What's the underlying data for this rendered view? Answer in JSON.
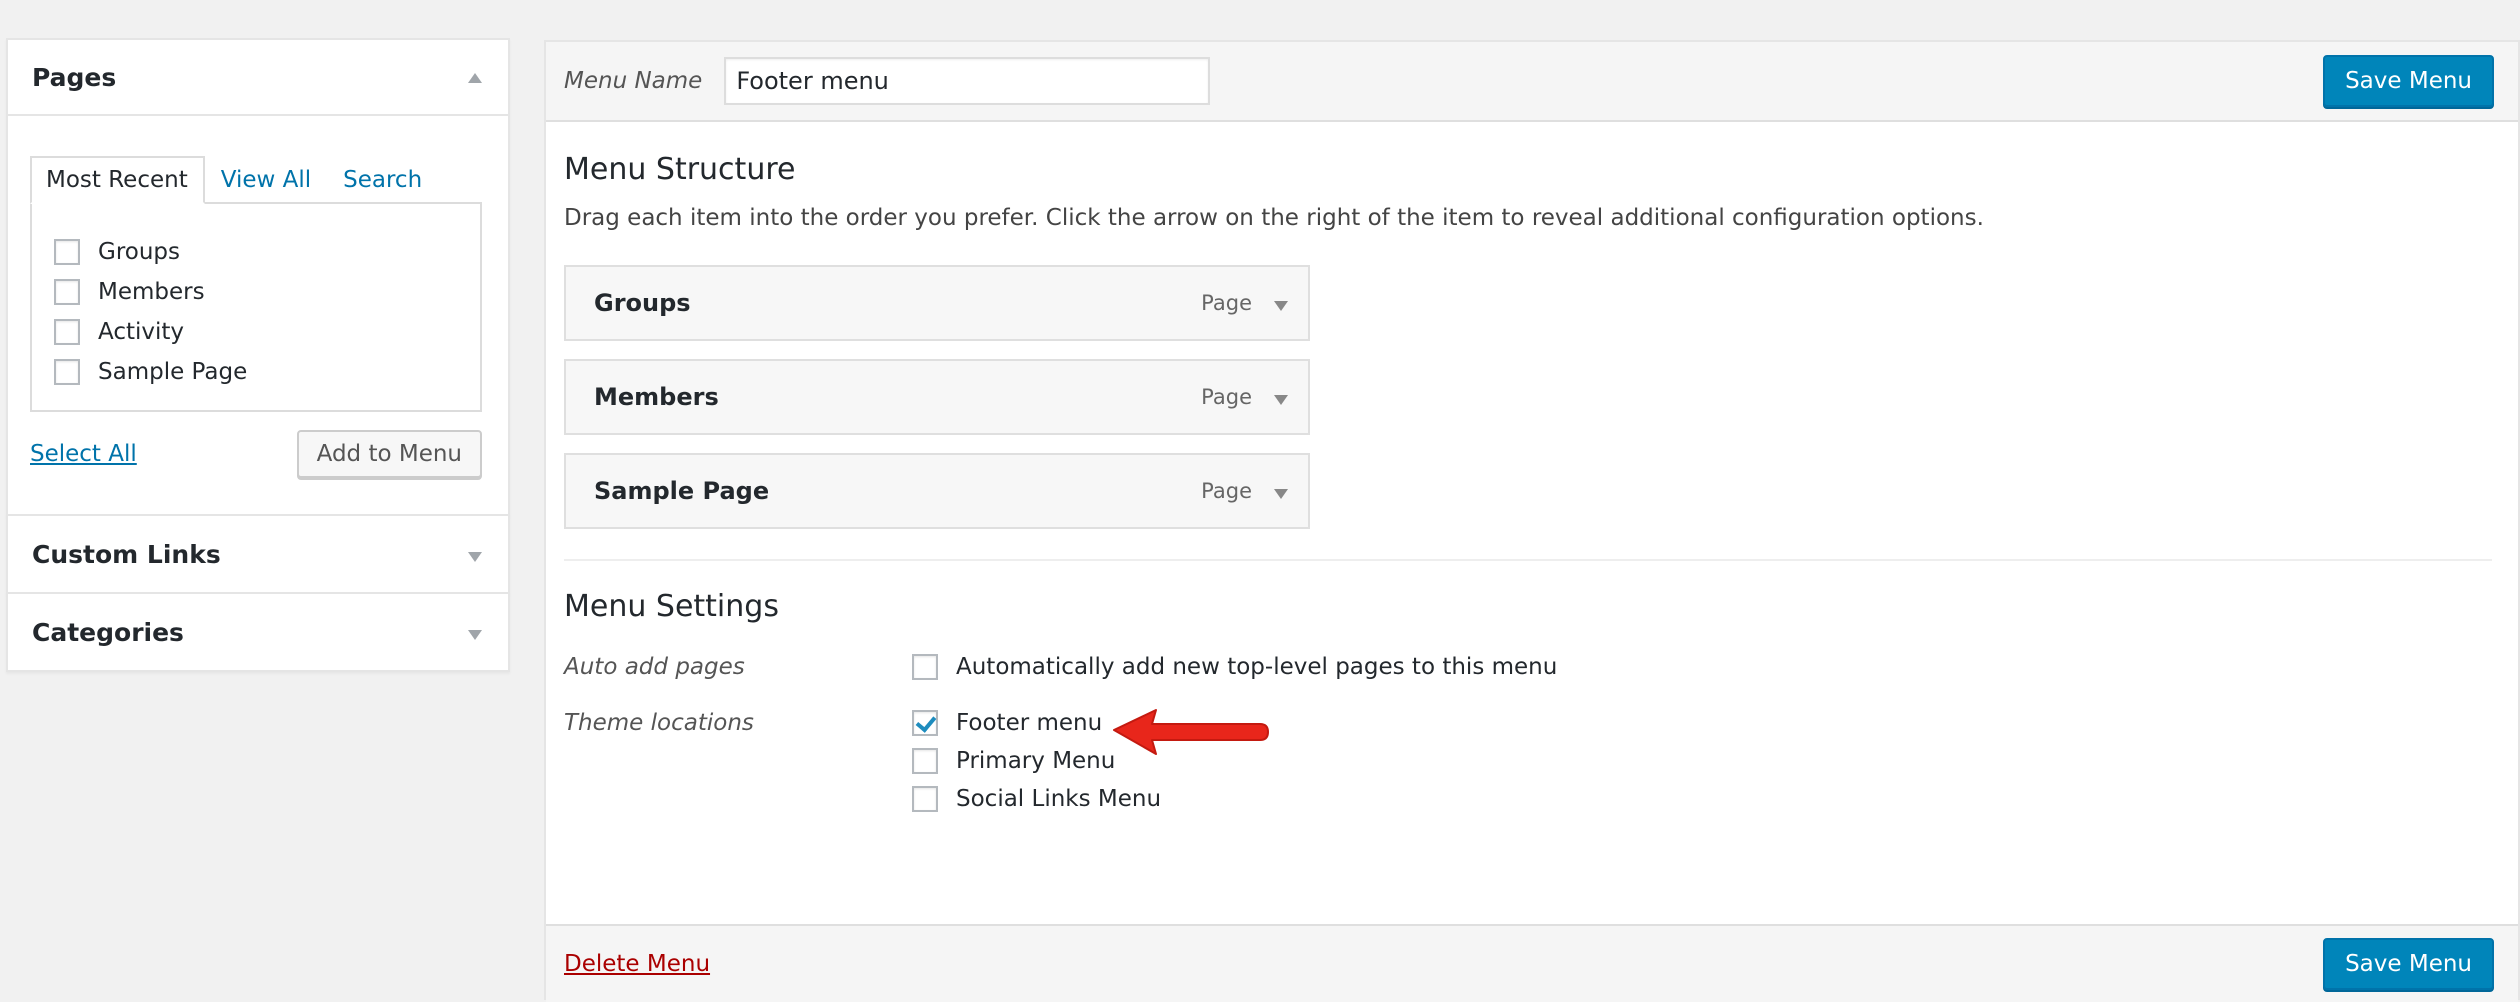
{
  "left_panel": {
    "pages": {
      "title": "Pages",
      "tabs": [
        {
          "label": "Most Recent",
          "active": true
        },
        {
          "label": "View All",
          "active": false
        },
        {
          "label": "Search",
          "active": false
        }
      ],
      "items": [
        {
          "label": "Groups",
          "checked": false
        },
        {
          "label": "Members",
          "checked": false
        },
        {
          "label": "Activity",
          "checked": false
        },
        {
          "label": "Sample Page",
          "checked": false
        }
      ],
      "select_all": "Select All",
      "add_to_menu": "Add to Menu"
    },
    "custom_links": {
      "title": "Custom Links"
    },
    "categories": {
      "title": "Categories"
    }
  },
  "editor": {
    "menu_name_label": "Menu Name",
    "menu_name_value": "Footer menu",
    "save_label": "Save Menu",
    "structure": {
      "title": "Menu Structure",
      "description": "Drag each item into the order you prefer. Click the arrow on the right of the item to reveal additional configuration options.",
      "items": [
        {
          "title": "Groups",
          "type": "Page"
        },
        {
          "title": "Members",
          "type": "Page"
        },
        {
          "title": "Sample Page",
          "type": "Page"
        }
      ]
    },
    "settings": {
      "title": "Menu Settings",
      "auto_add_label": "Auto add pages",
      "auto_add_option": {
        "label": "Automatically add new top-level pages to this menu",
        "checked": false
      },
      "theme_locations_label": "Theme locations",
      "locations": [
        {
          "label": "Footer menu",
          "checked": true
        },
        {
          "label": "Primary Menu",
          "checked": false
        },
        {
          "label": "Social Links Menu",
          "checked": false
        }
      ]
    },
    "delete_label": "Delete Menu"
  },
  "colors": {
    "primary_button": "#0085ba",
    "link": "#0073aa",
    "delete_link": "#aa0000",
    "callout_arrow": "#e8261b"
  }
}
